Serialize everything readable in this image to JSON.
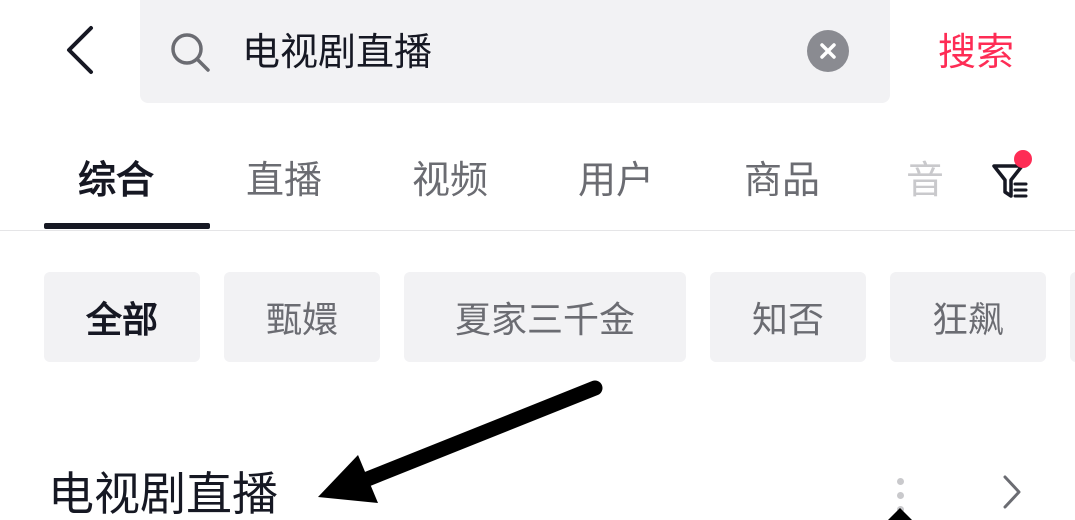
{
  "search": {
    "query": "电视剧直播",
    "submit_label": "搜索"
  },
  "tabs": [
    {
      "label": "综合"
    },
    {
      "label": "直播"
    },
    {
      "label": "视频"
    },
    {
      "label": "用户"
    },
    {
      "label": "商品"
    },
    {
      "label": "音"
    }
  ],
  "chips": [
    {
      "label": "全部"
    },
    {
      "label": "甄嬛"
    },
    {
      "label": "夏家三千金"
    },
    {
      "label": "知否"
    },
    {
      "label": "狂飙"
    }
  ],
  "section": {
    "title": "电视剧直播"
  },
  "colors": {
    "accent": "#fe2c55",
    "text_primary": "#161823",
    "text_secondary": "#6b6c72",
    "search_bg": "#f2f2f4"
  },
  "icons": {
    "back": "chevron-left-icon",
    "search": "search-icon",
    "clear": "clear-icon",
    "filter": "filter-icon",
    "more": "more-vertical-icon",
    "next": "chevron-right-icon"
  }
}
